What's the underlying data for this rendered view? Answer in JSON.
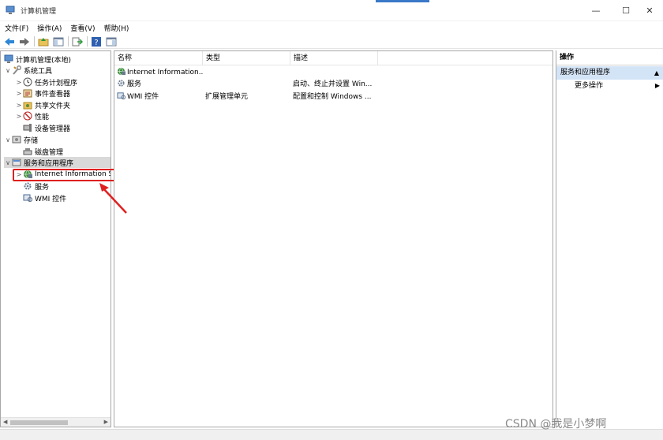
{
  "window": {
    "title": "计算机管理",
    "controls": [
      "—",
      "☐",
      "✕"
    ]
  },
  "menu": [
    "文件(F)",
    "操作(A)",
    "查看(V)",
    "帮助(H)"
  ],
  "toolbar": [
    "back-icon",
    "forward-icon",
    "up-folder-icon",
    "show-tree-icon",
    "export-icon",
    "help-icon",
    "properties-icon"
  ],
  "tree": {
    "items": [
      {
        "label": "计算机管理(本地)",
        "toggle": "",
        "icon": "computer-icon"
      },
      {
        "label": "系统工具",
        "toggle": "∨",
        "icon": "tools-icon"
      },
      {
        "label": "任务计划程序",
        "toggle": ">",
        "icon": "clock-icon"
      },
      {
        "label": "事件查看器",
        "toggle": ">",
        "icon": "event-viewer-icon"
      },
      {
        "label": "共享文件夹",
        "toggle": ">",
        "icon": "shared-folder-icon"
      },
      {
        "label": "性能",
        "toggle": ">",
        "icon": "performance-icon"
      },
      {
        "label": "设备管理器",
        "toggle": "",
        "icon": "device-manager-icon"
      },
      {
        "label": "存储",
        "toggle": "∨",
        "icon": "storage-icon"
      },
      {
        "label": "磁盘管理",
        "toggle": "",
        "icon": "disk-icon"
      },
      {
        "label": "服务和应用程序",
        "toggle": "∨",
        "icon": "services-apps-icon"
      },
      {
        "label": "Internet Information S",
        "toggle": ">",
        "icon": "iis-globe-icon"
      },
      {
        "label": "服务",
        "toggle": "",
        "icon": "gear-icon"
      },
      {
        "label": "WMI 控件",
        "toggle": "",
        "icon": "wmi-icon"
      }
    ]
  },
  "list": {
    "columns": [
      "名称",
      "类型",
      "描述"
    ],
    "rows": [
      {
        "name": "Internet Information...",
        "type": "",
        "desc": "",
        "icon": "iis-globe-icon"
      },
      {
        "name": "服务",
        "type": "",
        "desc": "启动、终止并设置 Win...",
        "icon": "gear-icon"
      },
      {
        "name": "WMI 控件",
        "type": "扩展管理单元",
        "desc": "配置和控制 Windows ...",
        "icon": "wmi-icon"
      }
    ]
  },
  "actions": {
    "header": "操作",
    "section": "服务和应用程序",
    "items": [
      "更多操作"
    ]
  },
  "watermark": "CSDN @我是小梦啊"
}
